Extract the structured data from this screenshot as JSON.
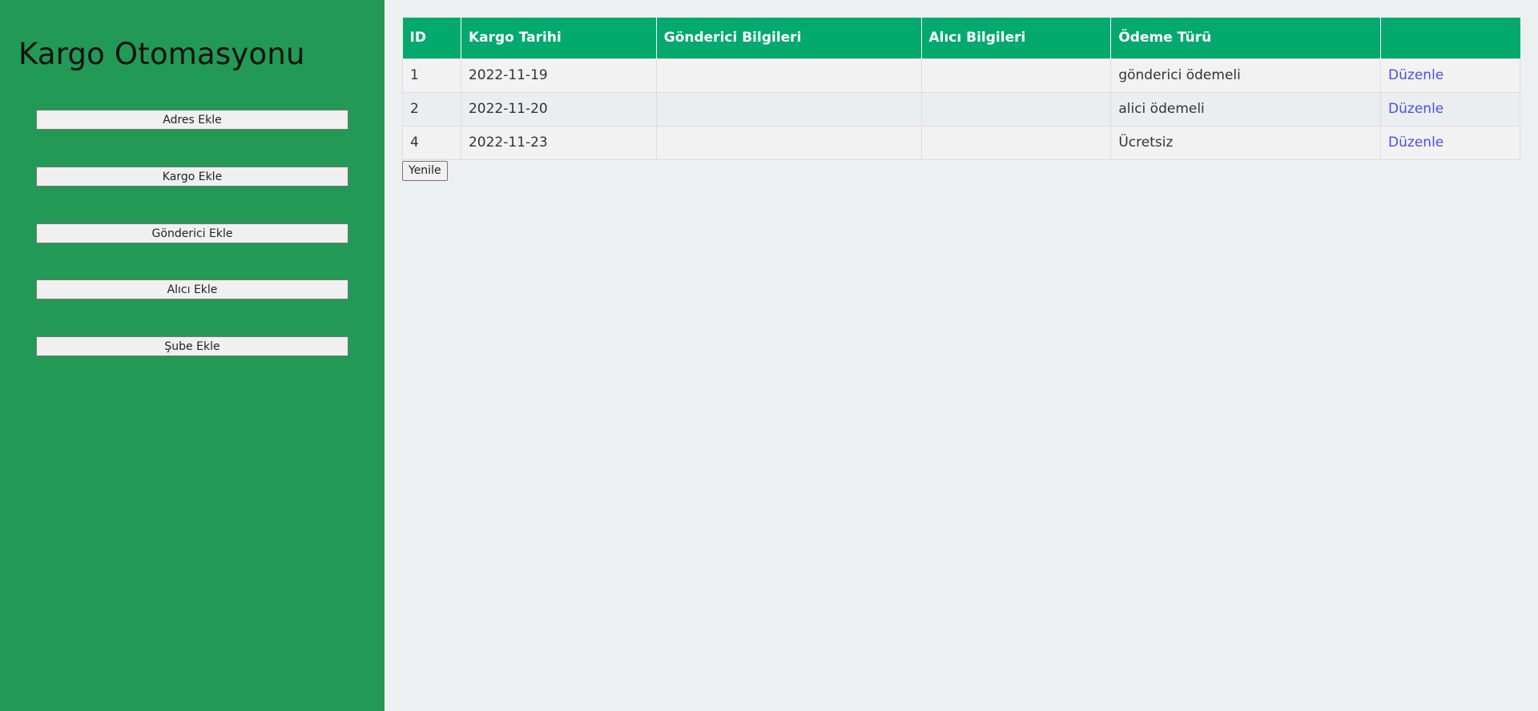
{
  "app": {
    "title": "Kargo Otomasyonu"
  },
  "sidebar": {
    "buttons": [
      {
        "label": "Adres Ekle"
      },
      {
        "label": "Kargo Ekle"
      },
      {
        "label": "Gönderici Ekle"
      },
      {
        "label": "Alıcı Ekle"
      },
      {
        "label": "Şube Ekle"
      }
    ]
  },
  "table": {
    "headers": [
      "ID",
      "Kargo Tarihi",
      "Gönderici Bilgileri",
      "Alıcı Bilgileri",
      "Ödeme Türü",
      ""
    ],
    "rows": [
      {
        "id": "1",
        "date": "2022-11-19",
        "sender": "",
        "receiver": "",
        "payment": "gönderici ödemeli",
        "action": "Düzenle"
      },
      {
        "id": "2",
        "date": "2022-11-20",
        "sender": "",
        "receiver": "",
        "payment": "alici ödemeli",
        "action": "Düzenle"
      },
      {
        "id": "4",
        "date": "2022-11-23",
        "sender": "",
        "receiver": "",
        "payment": "Ücretsiz",
        "action": "Düzenle"
      }
    ]
  },
  "actions": {
    "refresh_label": "Yenile"
  },
  "colors": {
    "sidebar_bg": "#229954",
    "header_bg": "#04a96d",
    "page_bg": "#ecf0f1",
    "link": "#4a4ee8"
  }
}
